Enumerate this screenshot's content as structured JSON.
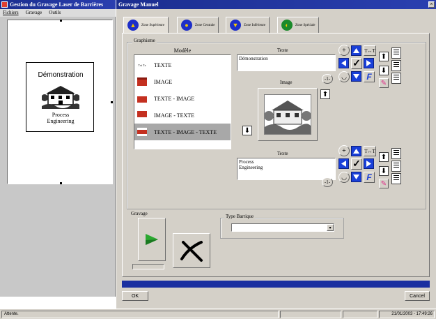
{
  "left_window": {
    "title": "Gestion du Gravage Laser de Barrières",
    "menu": [
      "Fichiers",
      "Gravage",
      "Outils"
    ],
    "preview": {
      "line1": "Démonstration",
      "line2": "Process",
      "line3": "Engineering"
    }
  },
  "dialog": {
    "title": "Gravage Manuel",
    "tabs": [
      "Zone Supérieure",
      "Zone Centrale",
      "Zone Inférieure",
      "Zone Spéciale"
    ],
    "graphisme_label": "Graphisme",
    "modele_header": "Modèle",
    "models": [
      {
        "icon": "text-icon",
        "label": "TEXTE"
      },
      {
        "icon": "image-icon",
        "label": "IMAGE"
      },
      {
        "icon": "text-image-icon",
        "label": "TEXTE - IMAGE"
      },
      {
        "icon": "image-text-icon",
        "label": "IMAGE - TEXTE"
      },
      {
        "icon": "text-image-text-icon",
        "label": "TEXTE - IMAGE - TEXTE",
        "selected": true
      }
    ],
    "texte_header_top": "Texte",
    "texte_top_value": "Démonstration",
    "image_header": "Image",
    "texte_header_bottom": "Texte",
    "texte_bottom_lines": [
      "Process",
      "Engineering"
    ],
    "gravage_label": "Gravage",
    "type_barrique_label": "Type Barrique",
    "type_barrique_value": "",
    "ok_label": "OK",
    "cancel_label": "Cancel"
  },
  "statusbar": {
    "left_text": "Attente.",
    "datetime": "21/01/2003 - 17:49:26"
  },
  "colors": {
    "title_blue": "#1b2e8f",
    "progress_blue": "#1a2fa0",
    "button_blue": "#1a40d8",
    "gravage_green": "#2aa830"
  }
}
